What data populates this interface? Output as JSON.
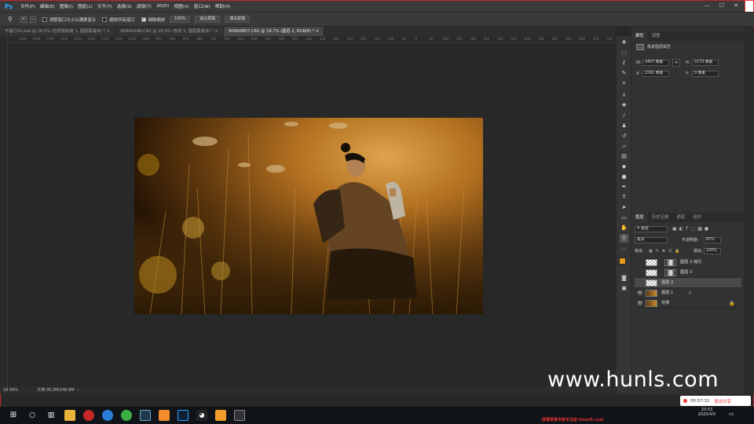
{
  "app": {
    "logo": "Ps",
    "menu": [
      "文件(F)",
      "编辑(E)",
      "图像(I)",
      "图层(L)",
      "文字(Y)",
      "选择(S)",
      "滤镜(T)",
      "3D(D)",
      "视图(V)",
      "窗口(W)",
      "帮助(H)"
    ]
  },
  "options": {
    "resize_window": "调整窗口大小以满屏显示",
    "zoom_all": "缩放所有窗口",
    "scrubby_zoom": "细微缩放",
    "zoom_value": "100%",
    "fit_screen": "适合屏幕",
    "fill_screen": "填充屏幕"
  },
  "tabs": [
    {
      "label": "不留行01.psd @ 16.5% (自然饱和度 1, 图层蒙版/8) *"
    },
    {
      "label": "9O6A9348.CR2 @ 18.4% (色阶 1, 图层蒙版/8) *"
    },
    {
      "label": "9O6A9857.CR2 @ 18.7% (图层 2, RGB/8) *"
    }
  ],
  "ruler_top": [
    "1450",
    "1400",
    "1350",
    "1300",
    "1250",
    "1200",
    "1150",
    "1100",
    "1050",
    "1000",
    "950",
    "900",
    "850",
    "800",
    "750",
    "700",
    "650",
    "600",
    "550",
    "500",
    "450",
    "400",
    "350",
    "300",
    "250",
    "200",
    "150",
    "100",
    "50",
    "0",
    "50",
    "100",
    "150",
    "200",
    "250",
    "300",
    "350",
    "400",
    "450",
    "500",
    "550",
    "600",
    "650",
    "700"
  ],
  "status": {
    "zoom": "18.69%",
    "doc": "文档:36.2M/146.8M"
  },
  "properties": {
    "tab_properties": "属性",
    "tab_adjust": "调整",
    "kind": "像素图层属性",
    "w_label": "W:",
    "w_value": "2457 像素",
    "h_label": "H:",
    "h_value": "2173 像素",
    "x_label": "X:",
    "x_value": "2291 像素",
    "y_label": "Y:",
    "y_value": "0 像素"
  },
  "layers_panel": {
    "tabs": [
      "图层",
      "历史记录",
      "通道",
      "动作"
    ],
    "filter_kind": "类型",
    "blend_mode": "柔光",
    "opacity_label": "不透明度:",
    "opacity_value": "65%",
    "lock_label": "锁定:",
    "fill_label": "填充:",
    "fill_value": "100%",
    "layers": [
      {
        "name": "图层 3 拷贝",
        "visible": false,
        "has_mask": true
      },
      {
        "name": "图层 3",
        "visible": false,
        "has_mask": true
      },
      {
        "name": "图层 2",
        "visible": false,
        "has_mask": false
      },
      {
        "name": "图层 1",
        "visible": true,
        "has_mask": false
      },
      {
        "name": "背景",
        "visible": true,
        "has_mask": false
      }
    ]
  },
  "recording": {
    "time": "00:57:32",
    "stop": "退出分享"
  },
  "sogou": {
    "label": "英"
  },
  "clock": {
    "time": "20:53",
    "date": "2020/4/5"
  },
  "watermark": "www.hunls.com",
  "banner": "屏幕录像专家未注册 tlxsoft.com"
}
